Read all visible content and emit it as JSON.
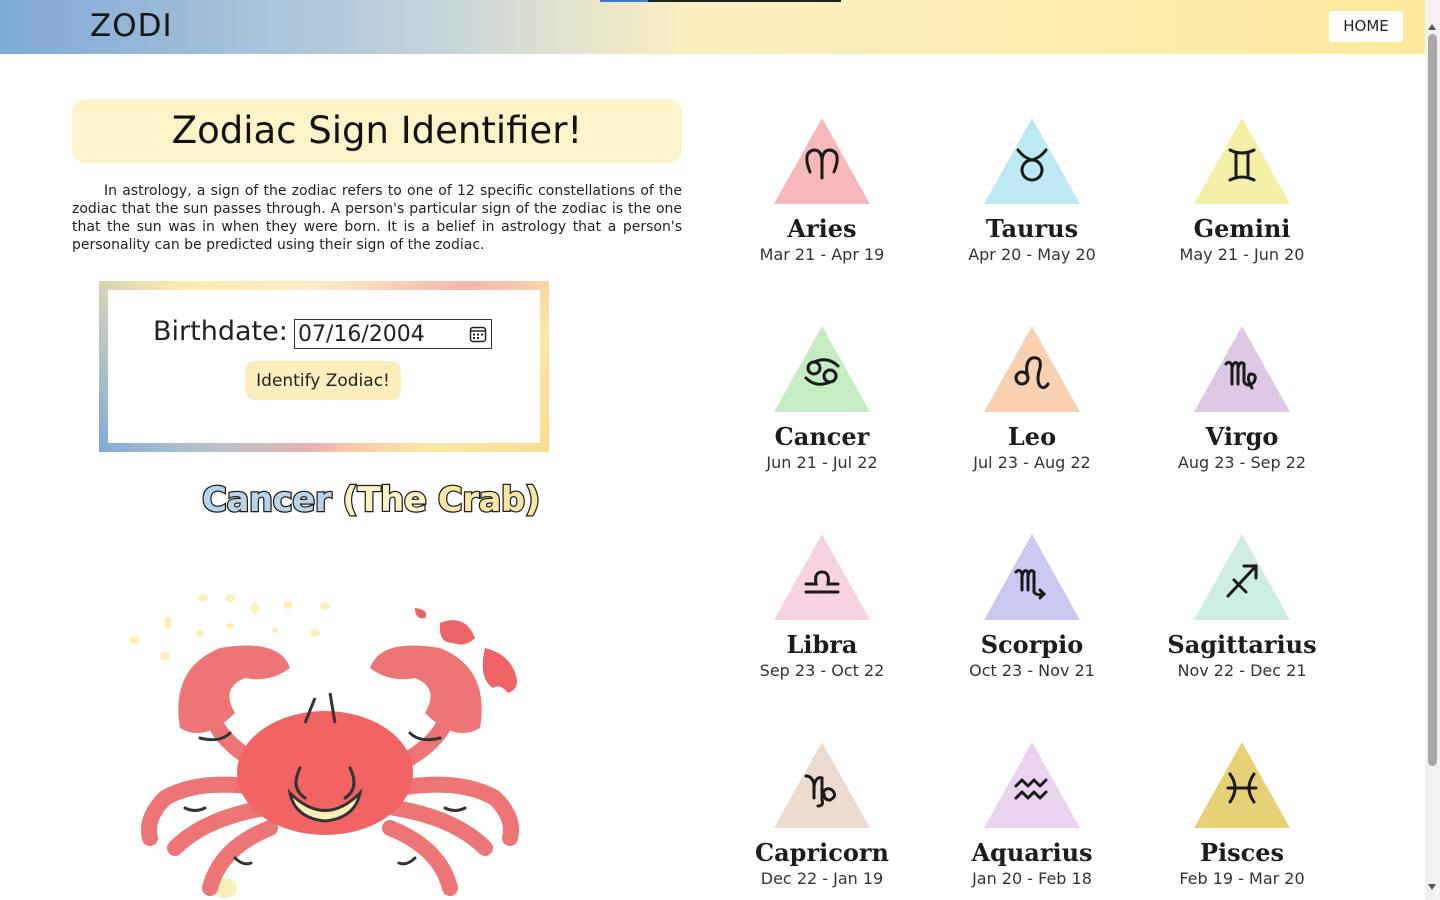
{
  "header": {
    "logo": "ZODI",
    "home_label": "HOME"
  },
  "main": {
    "title": "Zodiac Sign Identifier!",
    "intro": "In astrology, a sign of the zodiac refers to one of 12 specific constellations of the zodiac that the sun passes through. A person's particular sign of the zodiac is the one that the sun was in when they were born. It is a belief in astrology that a person's personality can be predicted using their sign of the zodiac.",
    "form": {
      "birthdate_label": "Birthdate:",
      "birthdate_value": "07/16/2004",
      "submit_label": "Identify Zodiac!"
    },
    "result": {
      "part1": "Cancer",
      "part2": " (The ",
      "part3": "Crab)"
    }
  },
  "signs": [
    {
      "name": "Aries",
      "dates": "Mar 21 - Apr 19",
      "color": "#f6b8bb",
      "glyph": "aries"
    },
    {
      "name": "Taurus",
      "dates": "Apr 20 - May 20",
      "color": "#bde9f3",
      "glyph": "taurus"
    },
    {
      "name": "Gemini",
      "dates": "May 21 - Jun 20",
      "color": "#f4f0a8",
      "glyph": "gemini"
    },
    {
      "name": "Cancer",
      "dates": "Jun 21 - Jul 22",
      "color": "#c7ebc2",
      "glyph": "cancer"
    },
    {
      "name": "Leo",
      "dates": "Jul 23 - Aug 22",
      "color": "#f7d1b2",
      "glyph": "leo"
    },
    {
      "name": "Virgo",
      "dates": "Aug 23 - Sep 22",
      "color": "#ddc8e6",
      "glyph": "virgo"
    },
    {
      "name": "Libra",
      "dates": "Sep 23 - Oct 22",
      "color": "#f6d2e3",
      "glyph": "libra"
    },
    {
      "name": "Scorpio",
      "dates": "Oct 23 - Nov 21",
      "color": "#c9c9f1",
      "glyph": "scorpio"
    },
    {
      "name": "Sagittarius",
      "dates": "Nov 22 - Dec 21",
      "color": "#cdeee0",
      "glyph": "sagittarius"
    },
    {
      "name": "Capricorn",
      "dates": "Dec 22 - Jan 19",
      "color": "#ecdcd0",
      "glyph": "capricorn"
    },
    {
      "name": "Aquarius",
      "dates": "Jan 20 - Feb 18",
      "color": "#ecd2f1",
      "glyph": "aquarius"
    },
    {
      "name": "Pisces",
      "dates": "Feb 19 - Mar 20",
      "color": "#e6d176",
      "glyph": "pisces"
    }
  ]
}
